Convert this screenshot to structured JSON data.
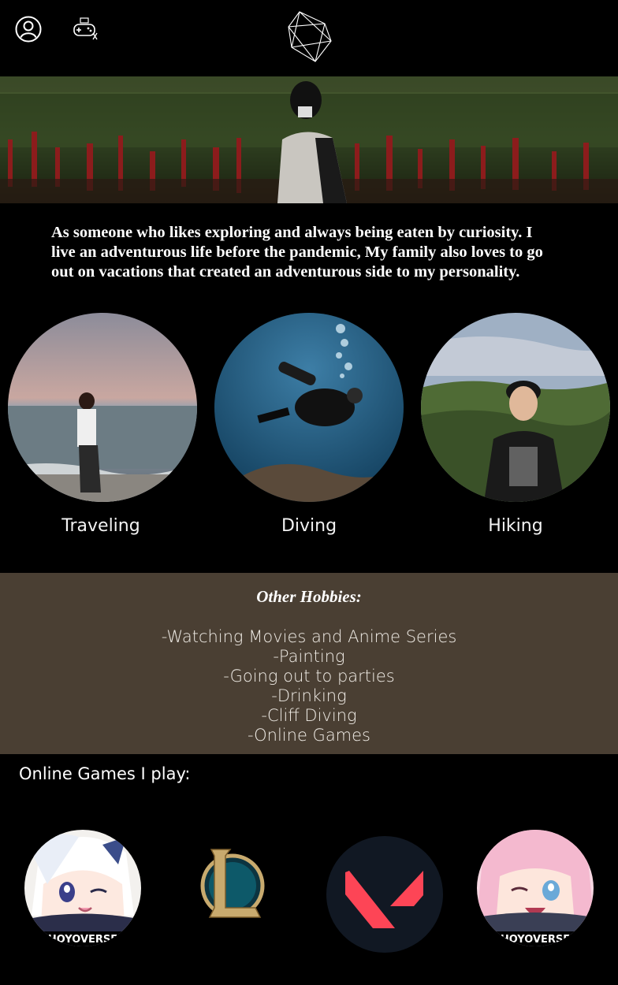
{
  "header": {
    "profile_icon": "user-circle-icon",
    "game_icon": "gamepad-icon",
    "logo_icon": "geometric-polyhedron-logo"
  },
  "intro": {
    "text": "As someone who likes exploring and always being eaten by curiosity. I live an adventurous life before the pandemic, My family also loves to go out on vacations that created an adventurous side to my personality."
  },
  "hobbies": [
    {
      "label": "Traveling"
    },
    {
      "label": "Diving"
    },
    {
      "label": "Hiking"
    }
  ],
  "other_hobbies": {
    "title": "Other Hobbies:",
    "items": [
      "-Watching Movies and Anime Series",
      "-Painting",
      "-Going out to parties",
      "-Drinking",
      "-Cliff Diving",
      "-Online Games"
    ]
  },
  "games": {
    "title": "Online Games I play:",
    "items": [
      {
        "name": "genshin-impact",
        "ribbon": "HOYOVERSE"
      },
      {
        "name": "league-of-legends",
        "ribbon": ""
      },
      {
        "name": "valorant",
        "ribbon": ""
      },
      {
        "name": "honkai-star-rail",
        "ribbon": "HOYOVERSE"
      }
    ]
  },
  "colors": {
    "background": "#000000",
    "other_hobbies_bg": "#4a3f33",
    "valorant_red": "#fd4556"
  }
}
